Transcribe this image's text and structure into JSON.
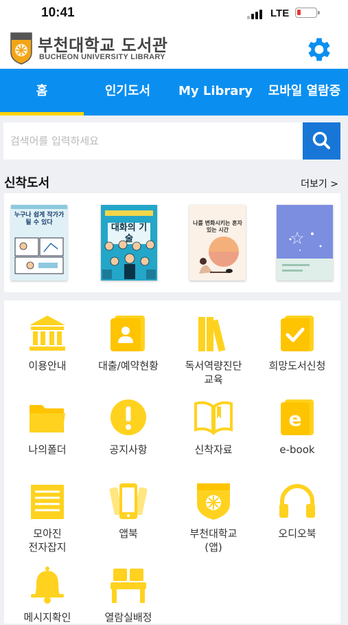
{
  "status_bar": {
    "time": "10:41",
    "network": "LTE"
  },
  "header": {
    "title": "부천대학교 도서관",
    "subtitle": "BUCHEON UNIVERSITY  LIBRARY"
  },
  "nav": {
    "tabs": [
      {
        "label": "홈"
      },
      {
        "label": "인기도서"
      },
      {
        "label": "My Library"
      },
      {
        "label": "모바일 열람증"
      }
    ]
  },
  "search": {
    "placeholder": "검색어를 입력하세요",
    "value": ""
  },
  "new_books": {
    "title": "신착도서",
    "more": "더보기 >",
    "books": [
      {
        "title": "누구나 쉽게 작가가 될 수 있다"
      },
      {
        "title": "대화의 기술"
      },
      {
        "title": "나를 변화시키는 혼자 있는 시간"
      },
      {
        "title": ""
      }
    ]
  },
  "menu": {
    "icon_color": "#ffd21f",
    "items": [
      {
        "label": "이용안내",
        "icon": "library-building-icon"
      },
      {
        "label": "대출/예약현황",
        "icon": "borrow-status-icon"
      },
      {
        "label": "독서역량진단\n교육",
        "icon": "books-icon"
      },
      {
        "label": "희망도서신청",
        "icon": "request-check-icon"
      },
      {
        "label": "나의폴더",
        "icon": "folder-icon"
      },
      {
        "label": "공지사항",
        "icon": "notice-icon"
      },
      {
        "label": "신착자료",
        "icon": "open-book-icon"
      },
      {
        "label": "e-book",
        "icon": "ebook-icon"
      },
      {
        "label": "모아진\n전자잡지",
        "icon": "magazine-icon"
      },
      {
        "label": "앱북",
        "icon": "appbook-icon"
      },
      {
        "label": "부천대학교\n(앱)",
        "icon": "university-emblem-icon"
      },
      {
        "label": "오디오북",
        "icon": "headphones-icon"
      },
      {
        "label": "메시지확인",
        "icon": "bell-icon"
      },
      {
        "label": "열람실배정",
        "icon": "seat-icon"
      }
    ]
  },
  "colors": {
    "nav": "#0a8ff0",
    "tab_indicator": "#ffd400",
    "search_button": "#1877d6",
    "settings": "#0a8ff0"
  }
}
